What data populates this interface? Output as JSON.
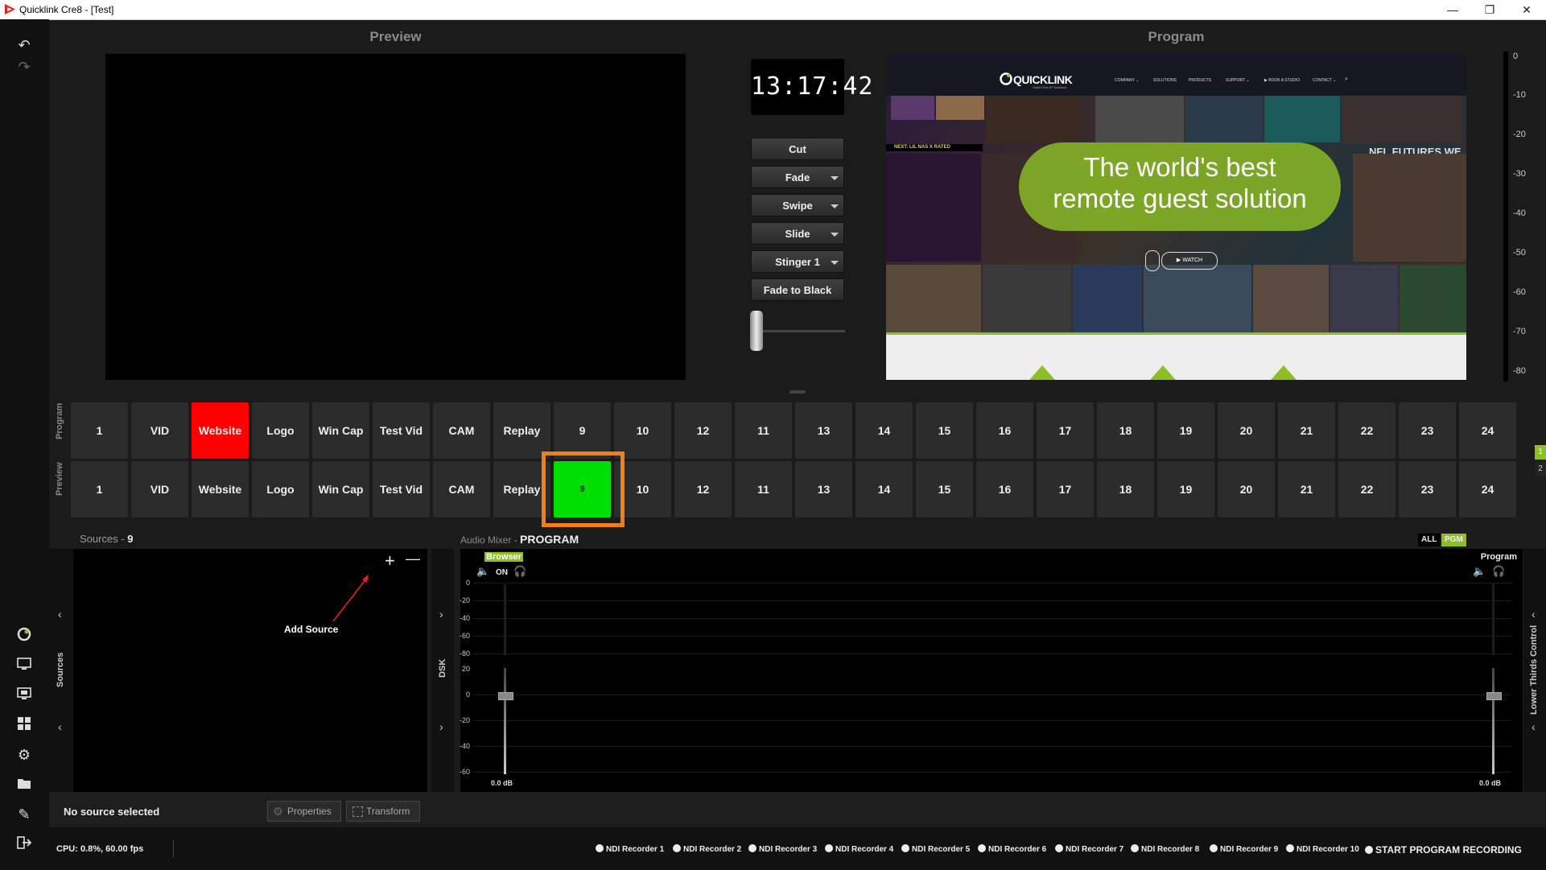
{
  "window": {
    "title": "Quicklink Cre8  - [Test]",
    "minimize": "—",
    "maximize": "❐",
    "close": "✕"
  },
  "sidebar": {
    "icons": [
      "undo-icon",
      "redo-icon",
      "quicklink-icon",
      "monitor-icon",
      "screen-share-icon",
      "grid-icon",
      "settings-icon",
      "folder-icon",
      "tools-icon",
      "exit-icon"
    ]
  },
  "preview": {
    "title": "Preview"
  },
  "program": {
    "title": "Program"
  },
  "clock": {
    "time": "13:17:42"
  },
  "transitions": [
    {
      "label": "Cut",
      "dropdown": false
    },
    {
      "label": "Fade",
      "dropdown": true
    },
    {
      "label": "Swipe",
      "dropdown": true
    },
    {
      "label": "Slide",
      "dropdown": true
    },
    {
      "label": "Stinger 1",
      "dropdown": true
    },
    {
      "label": "Fade to Black",
      "dropdown": false
    }
  ],
  "meter_ticks": [
    "0",
    "-10",
    "-20",
    "-30",
    "-40",
    "-50",
    "-60",
    "-70",
    "-80"
  ],
  "website": {
    "brand": "QUICKLINK",
    "tagline": "Video Over IP Solutions",
    "nav": [
      "COMPANY ⌄",
      "SOLUTIONS",
      "PRODUCTS",
      "SUPPORT ⌄",
      "▶ BOOK A STUDIO",
      "CONTACT ⌄",
      "⌕"
    ],
    "hero_line1": "The world's best",
    "hero_line2": "remote guest solution",
    "watch": "▶  WATCH",
    "banner1": "NEXT: LIL NAS X RATED",
    "banner2": "NFL FUTURES WE LIKE"
  },
  "rows": {
    "program_label": "Program",
    "preview_label": "Preview",
    "tiles": [
      "1",
      "VID",
      "Website",
      "Logo",
      "Win Cap",
      "Test Vid",
      "CAM",
      "Replay",
      "9",
      "10",
      "12",
      "11",
      "13",
      "14",
      "15",
      "16",
      "17",
      "18",
      "19",
      "20",
      "21",
      "22",
      "23",
      "24"
    ],
    "program_active": "Website",
    "preview_active": "9",
    "pages": [
      "1",
      "2"
    ]
  },
  "sources": {
    "label": "Sources",
    "count": "9",
    "side_label": "Sources",
    "add_hint": "Add Source",
    "add": "+",
    "remove": "—"
  },
  "dsk": {
    "label": "DSK"
  },
  "mixer": {
    "label": "Audio Mixer",
    "mode": "PROGRAM",
    "filter_all": "ALL",
    "filter_pgm": "PGM",
    "channel": "Browser",
    "on": "ON",
    "channel_db": "0.0 dB",
    "master": "Program",
    "master_db": "0.0 dB",
    "top_ticks": [
      "0",
      "-20",
      "-40",
      "-60",
      "-80"
    ],
    "bottom_ticks": [
      "20",
      "0",
      "-20",
      "-40",
      "-60"
    ]
  },
  "lower_thirds": {
    "label": "Lower Thirds Control"
  },
  "status": {
    "selection": "No source selected",
    "properties": "Properties",
    "transform": "Transform",
    "cpu": "CPU: 0.8%, 60.00 fps"
  },
  "recorders": [
    "NDI Recorder 1",
    "NDI Recorder 2",
    "NDI Recorder 3",
    "NDI Recorder 4",
    "NDI Recorder 5",
    "NDI Recorder 6",
    "NDI Recorder 7",
    "NDI Recorder 8",
    "NDI Recorder 9",
    "NDI Recorder 10"
  ],
  "record_program": "START PROGRAM RECORDING",
  "colors": {
    "program_active": "#ff0000",
    "preview_active": "#00e000",
    "highlight": "#f07f1a",
    "accent": "#8cbf26"
  }
}
